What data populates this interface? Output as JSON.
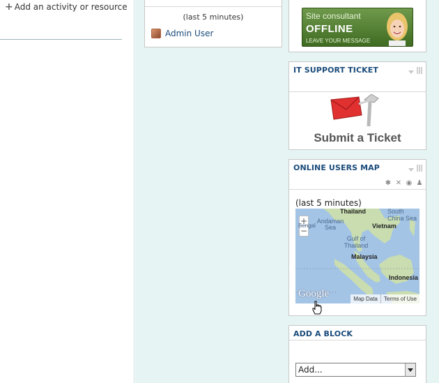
{
  "left": {
    "add_activity_label": "Add an activity or resource"
  },
  "online_users": {
    "last_text": "(last 5 minutes)",
    "user_name": "Admin User"
  },
  "consultant": {
    "line1": "Site consultant",
    "line2": "OFFLINE",
    "line3": "LEAVE YOUR MESSAGE"
  },
  "it_support": {
    "title": "IT SUPPORT TICKET",
    "button_text": "Submit a Ticket"
  },
  "users_map": {
    "title": "ONLINE USERS MAP",
    "last_text": "(last 5 minutes)",
    "zoom_in": "+",
    "zoom_out": "−",
    "labels": {
      "thailand": "Thailand",
      "andaman_sea": "Andaman Sea",
      "south_china_sea": "South China Sea",
      "vietnam": "Vietnam",
      "gulf_of_thailand": "Gulf of Thailand",
      "malaysia": "Malaysia",
      "indonesia": "Indonesia",
      "bengal_fragment": "Bengal"
    },
    "google_logo": "Google",
    "map_data": "Map Data",
    "terms": "Terms of Use"
  },
  "add_block": {
    "title": "ADD A BLOCK",
    "select_value": "Add..."
  },
  "colors": {
    "accent": "#1a4b7a",
    "content_bg": "#e6f4f4",
    "banner_green": "#4f7d2f",
    "ticket_red": "#d9262b"
  }
}
